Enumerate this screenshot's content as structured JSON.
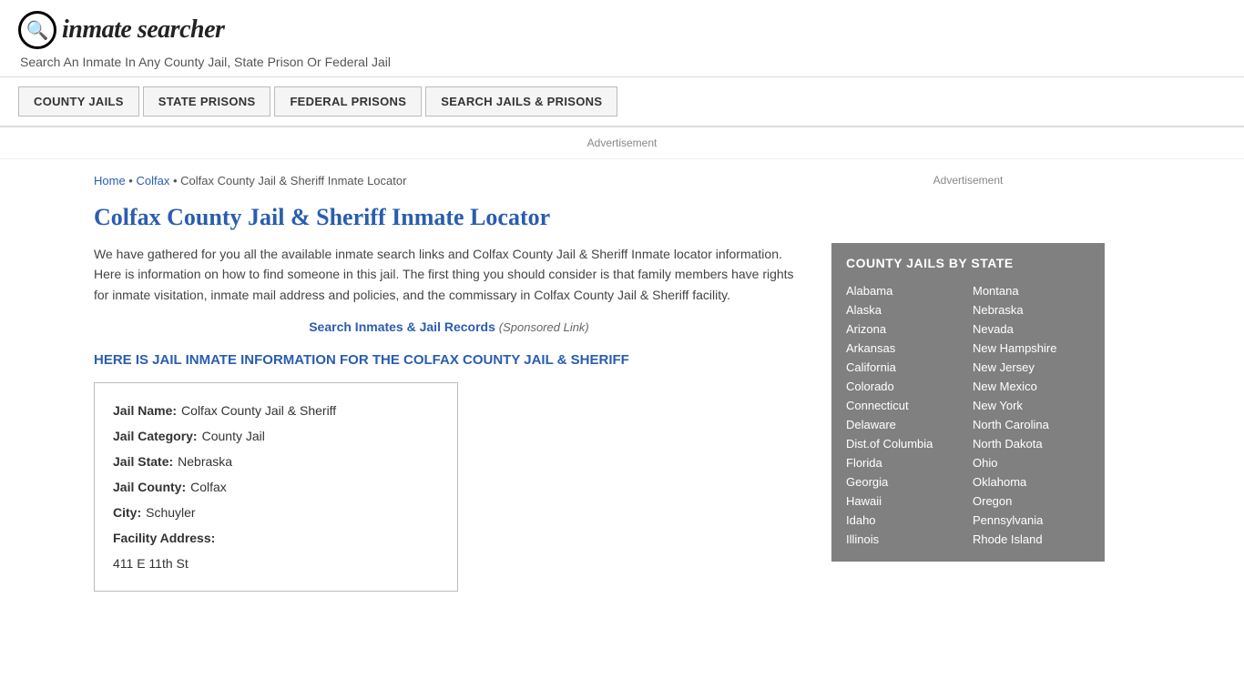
{
  "header": {
    "logo_icon": "🔍",
    "logo_text_1": "inmate",
    "logo_text_2": "searcher",
    "tagline": "Search An Inmate In Any County Jail, State Prison Or Federal Jail"
  },
  "nav": {
    "items": [
      {
        "label": "COUNTY JAILS",
        "href": "#"
      },
      {
        "label": "STATE PRISONS",
        "href": "#"
      },
      {
        "label": "FEDERAL PRISONS",
        "href": "#"
      },
      {
        "label": "SEARCH JAILS & PRISONS",
        "href": "#"
      }
    ]
  },
  "ad": {
    "label": "Advertisement"
  },
  "breadcrumb": {
    "home": "Home",
    "parent": "Colfax",
    "current": "Colfax County Jail & Sheriff Inmate Locator"
  },
  "page": {
    "title": "Colfax County Jail & Sheriff Inmate Locator",
    "intro": "We have gathered for you all the available inmate search links and Colfax County Jail & Sheriff Inmate locator information. Here is information on how to find someone in this jail. The first thing you should consider is that family members have rights for inmate visitation, inmate mail address and policies, and the commissary in Colfax County Jail & Sheriff facility.",
    "search_link_label": "Search Inmates & Jail Records",
    "search_link_sponsored": "(Sponsored Link)",
    "info_heading": "HERE IS JAIL INMATE INFORMATION FOR THE COLFAX COUNTY JAIL & SHERIFF"
  },
  "jail_info": {
    "name_label": "Jail Name:",
    "name_value": "Colfax County Jail & Sheriff",
    "category_label": "Jail Category:",
    "category_value": "County Jail",
    "state_label": "Jail State:",
    "state_value": "Nebraska",
    "county_label": "Jail County:",
    "county_value": "Colfax",
    "city_label": "City:",
    "city_value": "Schuyler",
    "address_label": "Facility Address:",
    "address_value": "411 E 11th St"
  },
  "sidebar": {
    "ad_label": "Advertisement",
    "section_title": "COUNTY JAILS BY STATE",
    "states_col1": [
      "Alabama",
      "Alaska",
      "Arizona",
      "Arkansas",
      "California",
      "Colorado",
      "Connecticut",
      "Delaware",
      "Dist.of Columbia",
      "Florida",
      "Georgia",
      "Hawaii",
      "Idaho",
      "Illinois"
    ],
    "states_col2": [
      "Montana",
      "Nebraska",
      "Nevada",
      "New Hampshire",
      "New Jersey",
      "New Mexico",
      "New York",
      "North Carolina",
      "North Dakota",
      "Ohio",
      "Oklahoma",
      "Oregon",
      "Pennsylvania",
      "Rhode Island"
    ]
  }
}
